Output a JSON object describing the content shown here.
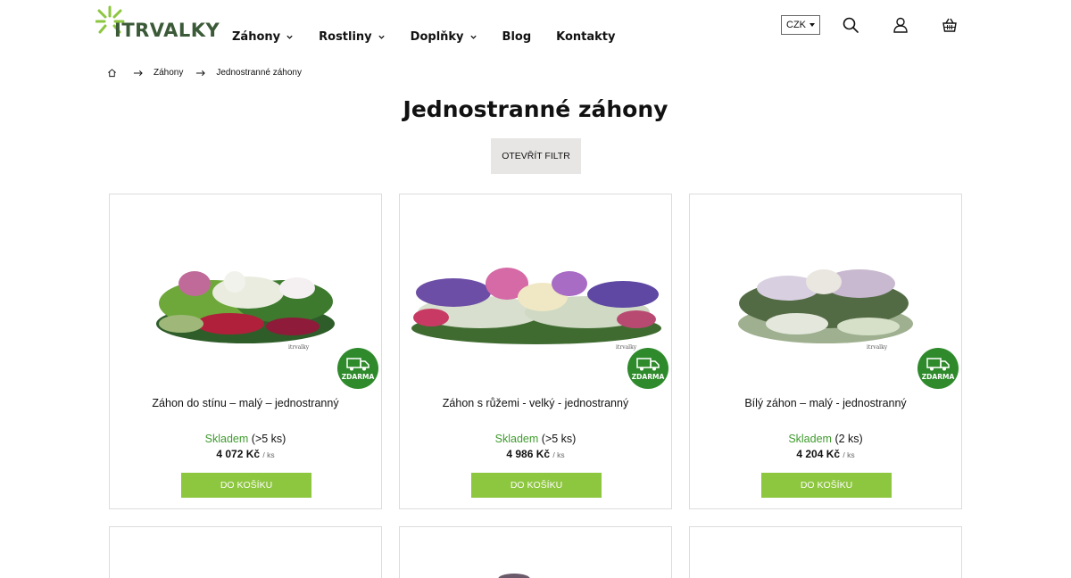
{
  "brand": {
    "name": "ITRVALKY",
    "accent": "#8dc63f",
    "dark_green": "#2f8a2c",
    "logo_green": "#3b5a38"
  },
  "nav": {
    "items": [
      {
        "label": "Záhony",
        "has_dropdown": true
      },
      {
        "label": "Rostliny",
        "has_dropdown": true
      },
      {
        "label": "Doplňky",
        "has_dropdown": true
      },
      {
        "label": "Blog",
        "has_dropdown": false
      },
      {
        "label": "Kontakty",
        "has_dropdown": false
      }
    ]
  },
  "header": {
    "currency": "CZK",
    "icons": [
      "search-icon",
      "user-icon",
      "basket-icon"
    ]
  },
  "breadcrumb": {
    "home_icon": "home-icon",
    "items": [
      "Záhony",
      "Jednostranné záhony"
    ]
  },
  "page": {
    "title": "Jednostranné záhony",
    "filter_button": "OTEVŘÍT FILTR"
  },
  "products": [
    {
      "name": "Záhon do stínu – malý – jednostranný",
      "stock_status": "Skladem",
      "stock_qty": "(>5 ks)",
      "price": "4 072 Kč",
      "unit": "/ ks",
      "badge": "ZDARMA",
      "button": "DO KOŠÍKU",
      "image_signature": "itrvalky"
    },
    {
      "name": "Záhon s růžemi - velký - jednostranný",
      "stock_status": "Skladem",
      "stock_qty": "(>5 ks)",
      "price": "4 986 Kč",
      "unit": "/ ks",
      "badge": "ZDARMA",
      "button": "DO KOŠÍKU",
      "image_signature": "itrvalky"
    },
    {
      "name": "Bílý záhon – malý - jednostranný",
      "stock_status": "Skladem",
      "stock_qty": "(2 ks)",
      "price": "4 204 Kč",
      "unit": "/ ks",
      "badge": "ZDARMA",
      "button": "DO KOŠÍKU",
      "image_signature": "itrvalky"
    }
  ]
}
